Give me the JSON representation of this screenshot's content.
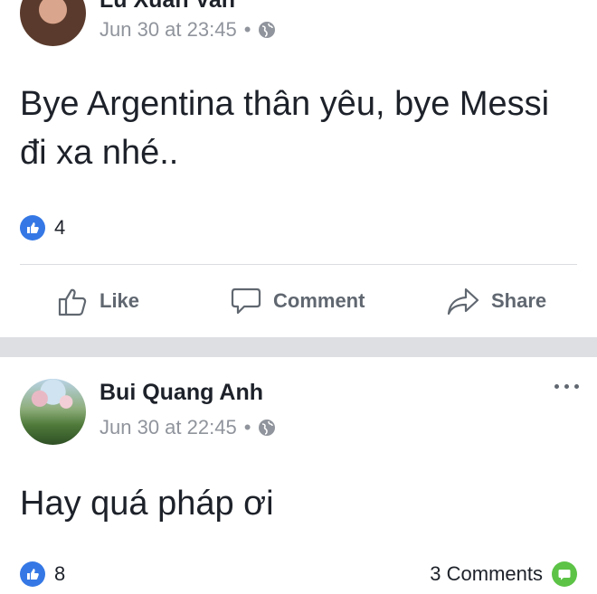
{
  "posts": [
    {
      "author": "Lu Xuan Van",
      "time": "Jun 30 at 23:45",
      "separator": "•",
      "text": "Bye Argentina thân yêu, bye Messi đi xa nhé..",
      "likes": "4"
    },
    {
      "author": "Bui Quang Anh",
      "time": "Jun 30 at 22:45",
      "separator": "•",
      "text": "Hay quá pháp ơi",
      "likes": "8",
      "comments": "3 Comments"
    }
  ],
  "actions": {
    "like": "Like",
    "comment": "Comment",
    "share": "Share"
  },
  "icons": [
    "globe-icon",
    "like-badge-icon",
    "thumbs-up-icon",
    "comment-bubble-icon",
    "share-arrow-icon",
    "more-icon",
    "comment-badge-icon"
  ],
  "colors": {
    "like_blue": "#3578e5",
    "comment_green": "#5cc346",
    "meta_gray": "#90949c",
    "action_gray": "#606770",
    "divider": "#dddfe2"
  }
}
